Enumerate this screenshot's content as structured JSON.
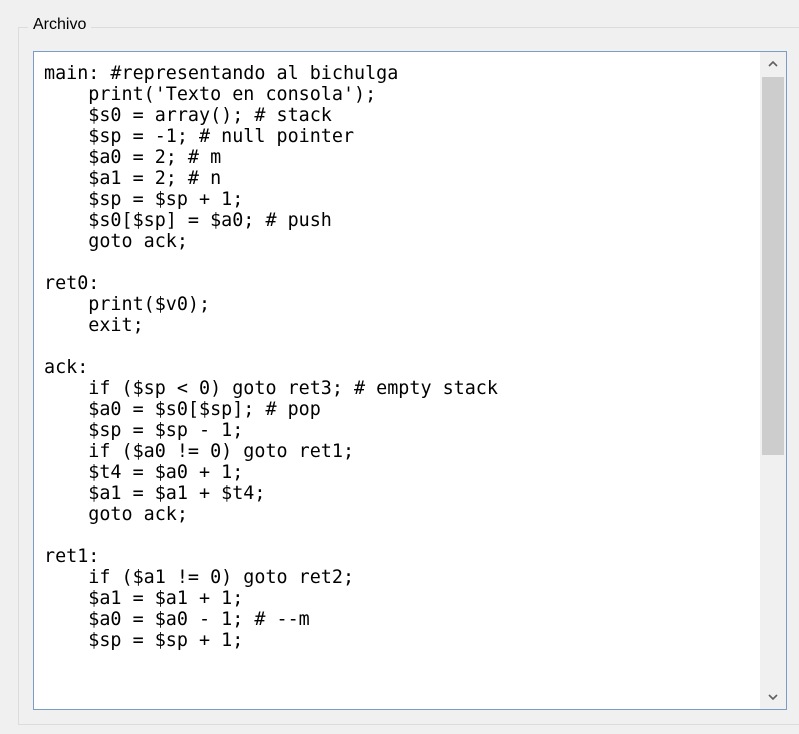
{
  "group": {
    "label": "Archivo"
  },
  "editor": {
    "lines": [
      "main: #representando al bichulga",
      "    print('Texto en consola');",
      "    $s0 = array(); # stack",
      "    $sp = -1; # null pointer",
      "    $a0 = 2; # m",
      "    $a1 = 2; # n",
      "    $sp = $sp + 1;",
      "    $s0[$sp] = $a0; # push",
      "    goto ack;",
      "",
      "ret0:",
      "    print($v0);",
      "    exit;",
      "",
      "ack:",
      "    if ($sp < 0) goto ret3; # empty stack",
      "    $a0 = $s0[$sp]; # pop",
      "    $sp = $sp - 1;",
      "    if ($a0 != 0) goto ret1;",
      "    $t4 = $a0 + 1;",
      "    $a1 = $a1 + $t4;",
      "    goto ack;",
      "",
      "ret1:",
      "    if ($a1 != 0) goto ret2;",
      "    $a1 = $a1 + 1;",
      "    $a0 = $a0 - 1; # --m",
      "    $sp = $sp + 1;"
    ]
  },
  "scrollbar": {
    "up_icon": "chevron-up-icon",
    "down_icon": "chevron-down-icon",
    "position": 0.0
  },
  "colors": {
    "window_bg": "#f0f0f0",
    "editor_border": "#7a9cc6",
    "thumb": "#cdcdcd"
  }
}
